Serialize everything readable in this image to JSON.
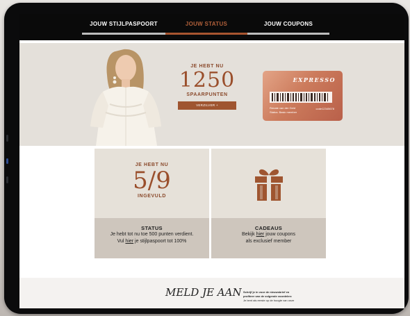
{
  "nav": {
    "tabs": [
      {
        "label": "JOUW STIJLPASPOORT"
      },
      {
        "label": "JOUW STATUS"
      },
      {
        "label": "JOUW COUPONS"
      }
    ],
    "active_index": 1
  },
  "hero": {
    "eyebrow": "JE HEBT NU",
    "points": "1250",
    "points_label": "SPAARPUNTEN",
    "button_label": "VERZILVER +"
  },
  "card": {
    "brand": "EXPRESSO",
    "holder_name": "Renate van der Geld",
    "holder_status": "Status: Basic member",
    "card_number": "code12345678"
  },
  "status_tile": {
    "eyebrow": "JE HEBT NU",
    "fraction": "5/9",
    "caption": "INGEVULD",
    "title": "STATUS",
    "line1": "Je hebt tot nu toe 500 punten verdient.",
    "line2_prefix": "Vul ",
    "line2_link": "hier",
    "line2_suffix": " je stijlpaspoort tot 100%"
  },
  "cadeau_tile": {
    "icon": "gift-icon",
    "title": "CADEAUS",
    "line1_prefix": "Bekijk ",
    "line1_link": "hier",
    "line1_suffix": " jouw coupons",
    "line2": "als exclusief member"
  },
  "newsletter": {
    "heading": "MELD JE AAN",
    "intro": "Schrijf je in voor de nieuwsbrief en",
    "intro2": "profiteer van de volgende voordelen:",
    "detail": "Je bent als eerste op de hoogte van onze"
  },
  "colors": {
    "accent": "#9f5530",
    "nav_bg": "#0a0a0a",
    "hero_bg": "#e4e0da",
    "tile_top": "#e6e1d9",
    "tile_bottom": "#cec6bd"
  }
}
